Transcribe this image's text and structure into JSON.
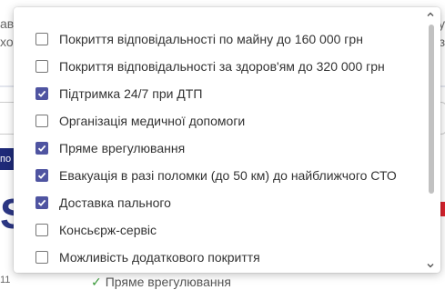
{
  "background": {
    "fragment_1": "ав",
    "fragment_2": "хо",
    "nav_fragment": "по",
    "big_letter": "S",
    "row_number": "11",
    "peek_text": "Пряме врегулювання",
    "right_fragment_1": "у",
    "right_fragment_2": "з"
  },
  "dropdown": {
    "options": [
      {
        "label": "Покриття відповідальності по майну до 160 000 грн",
        "checked": false
      },
      {
        "label": "Покриття відповідальності за здоров'ям до 320 000 грн",
        "checked": false
      },
      {
        "label": "Підтримка 24/7 при ДТП",
        "checked": true
      },
      {
        "label": "Організація медичної допомоги",
        "checked": false
      },
      {
        "label": "Пряме врегулювання",
        "checked": true
      },
      {
        "label": "Евакуація в разі поломки (до 50 км) до найближчого СТО",
        "checked": true
      },
      {
        "label": "Доставка пального",
        "checked": true
      },
      {
        "label": "Консьєрж-сервіс",
        "checked": false
      },
      {
        "label": "Можливість додаткового покриття",
        "checked": false
      }
    ]
  },
  "colors": {
    "checkbox_checked": "#4f54a1",
    "checkbox_border": "#767676",
    "scrollbar_thumb": "#c1c1c1"
  }
}
